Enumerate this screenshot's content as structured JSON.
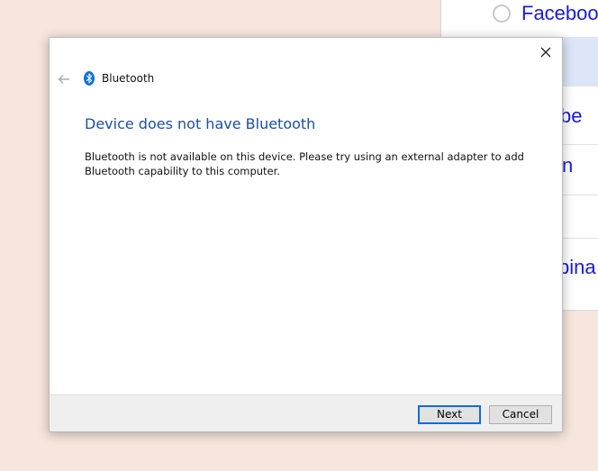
{
  "background": {
    "items": [
      {
        "label": "Facebook"
      },
      {
        "label": ""
      },
      {
        "label": "be"
      },
      {
        "label": "n"
      },
      {
        "label": ""
      },
      {
        "label": "bina"
      }
    ]
  },
  "dialog": {
    "title": "Bluetooth",
    "heading": "Device does not have Bluetooth",
    "message": "Bluetooth is not available on this device. Please try using an external adapter to add Bluetooth capability to this computer.",
    "next_label": "Next",
    "cancel_label": "Cancel"
  },
  "colors": {
    "background": "#f7e6dd",
    "heading": "#1d4fa2",
    "bluetooth_icon": "#0a74d8",
    "primary_button_border": "#0f6cd6",
    "link_text": "#1a1ad9"
  }
}
